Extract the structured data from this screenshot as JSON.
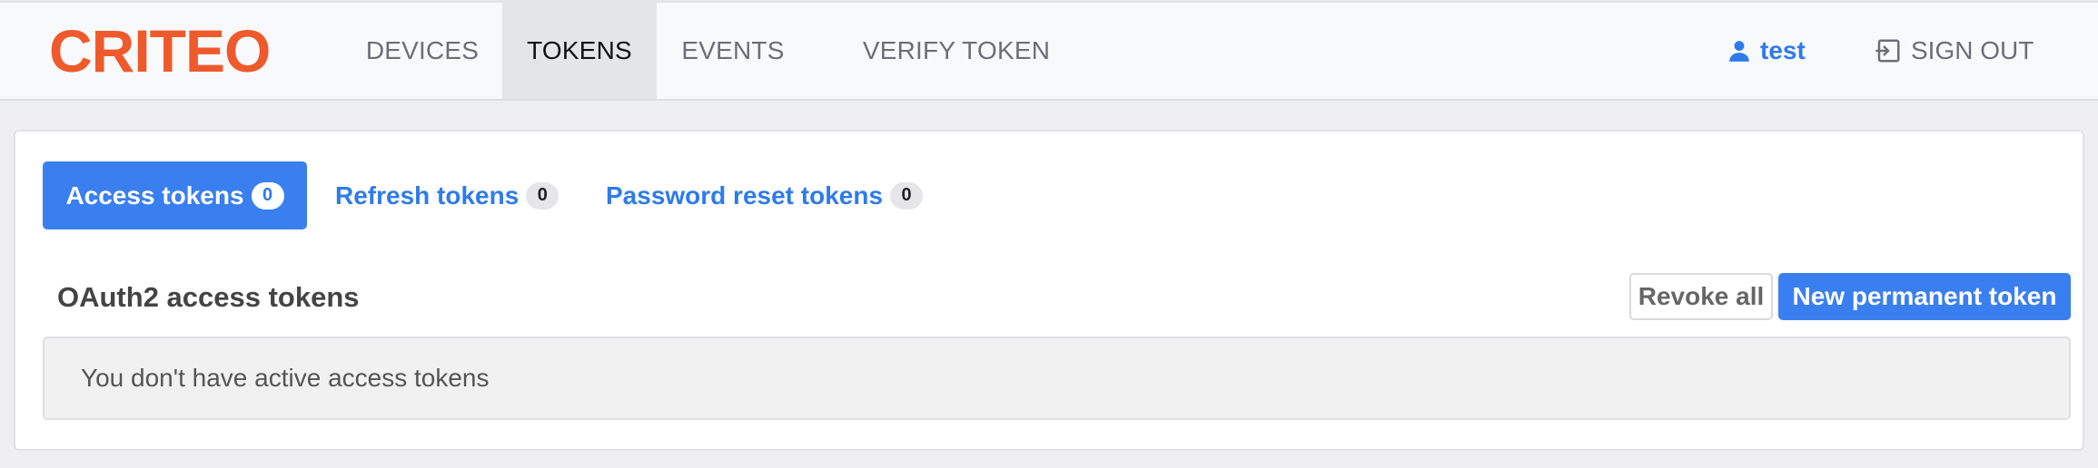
{
  "brand": {
    "name": "CRITEO",
    "color": "#ee5a2b"
  },
  "nav": {
    "items": [
      {
        "label": "DEVICES",
        "active": false
      },
      {
        "label": "TOKENS",
        "active": true
      },
      {
        "label": "EVENTS",
        "active": false
      },
      {
        "label": "VERIFY TOKEN",
        "active": false
      }
    ],
    "user": {
      "label": "test",
      "icon": "user-icon"
    },
    "signout": {
      "label": "SIGN OUT",
      "icon": "sign-out-icon"
    }
  },
  "tabs": [
    {
      "label": "Access tokens",
      "count": "0",
      "active": true
    },
    {
      "label": "Refresh tokens",
      "count": "0",
      "active": false
    },
    {
      "label": "Password reset tokens",
      "count": "0",
      "active": false
    }
  ],
  "section": {
    "title": "OAuth2 access tokens",
    "revoke_label": "Revoke all",
    "new_label": "New permanent token",
    "empty_message": "You don't have active access tokens"
  },
  "colors": {
    "accent": "#3a7ff0",
    "link": "#2f7bea"
  }
}
